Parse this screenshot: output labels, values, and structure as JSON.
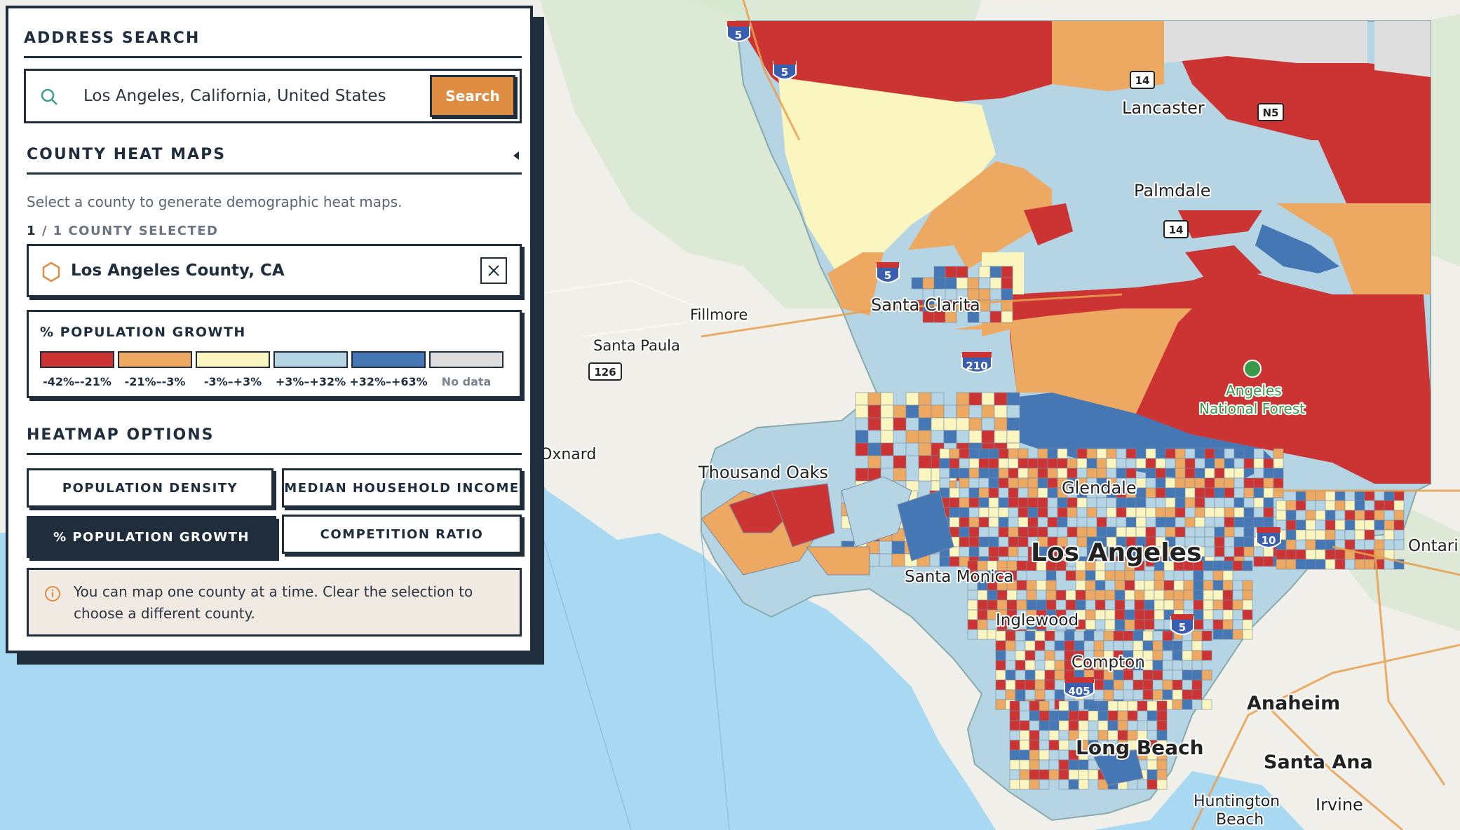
{
  "address_search": {
    "title": "ADDRESS SEARCH",
    "value": "Los Angeles, California, United States",
    "button": "Search"
  },
  "county_heat_maps": {
    "title": "COUNTY HEAT MAPS",
    "instructions": "Select a county to generate demographic heat maps.",
    "count_number": "1",
    "count_text": "/ 1 COUNTY SELECTED",
    "selected_county": "Los Angeles County, CA"
  },
  "legend": {
    "title": "% POPULATION GROWTH",
    "items": [
      {
        "label": "-42%–-21%",
        "color": "#cc3333"
      },
      {
        "label": "-21%–-3%",
        "color": "#eda862"
      },
      {
        "label": "-3%–+3%",
        "color": "#fbf5bf"
      },
      {
        "label": "+3%–+32%",
        "color": "#b5d4e4"
      },
      {
        "label": "+32%–+63%",
        "color": "#4577b5"
      },
      {
        "label": "No data",
        "color": "#dedede"
      }
    ]
  },
  "heatmap_options": {
    "title": "HEATMAP OPTIONS",
    "options": [
      {
        "label": "POPULATION DENSITY",
        "active": false
      },
      {
        "label": "MEDIAN HOUSEHOLD INCOME",
        "active": false
      },
      {
        "label": "% POPULATION GROWTH",
        "active": true
      },
      {
        "label": "COMPETITION RATIO",
        "active": false
      }
    ]
  },
  "note": "You can map one county at a time. Clear the selection to choose a different county.",
  "map": {
    "places": [
      "Lancaster",
      "Palmdale",
      "Santa Clarita",
      "Fillmore",
      "Santa Paula",
      "Oxnard",
      "Thousand Oaks",
      "Glendale",
      "Los Angeles",
      "Santa Monica",
      "Inglewood",
      "Compton",
      "Long Beach",
      "Anaheim",
      "Santa Ana",
      "Huntington",
      "Beach",
      "Irvine",
      "Ontari",
      "Angeles",
      "National Forest"
    ],
    "shields": [
      "5",
      "5",
      "14",
      "N5",
      "14",
      "5",
      "126",
      "210",
      "10",
      "5",
      "405"
    ]
  }
}
